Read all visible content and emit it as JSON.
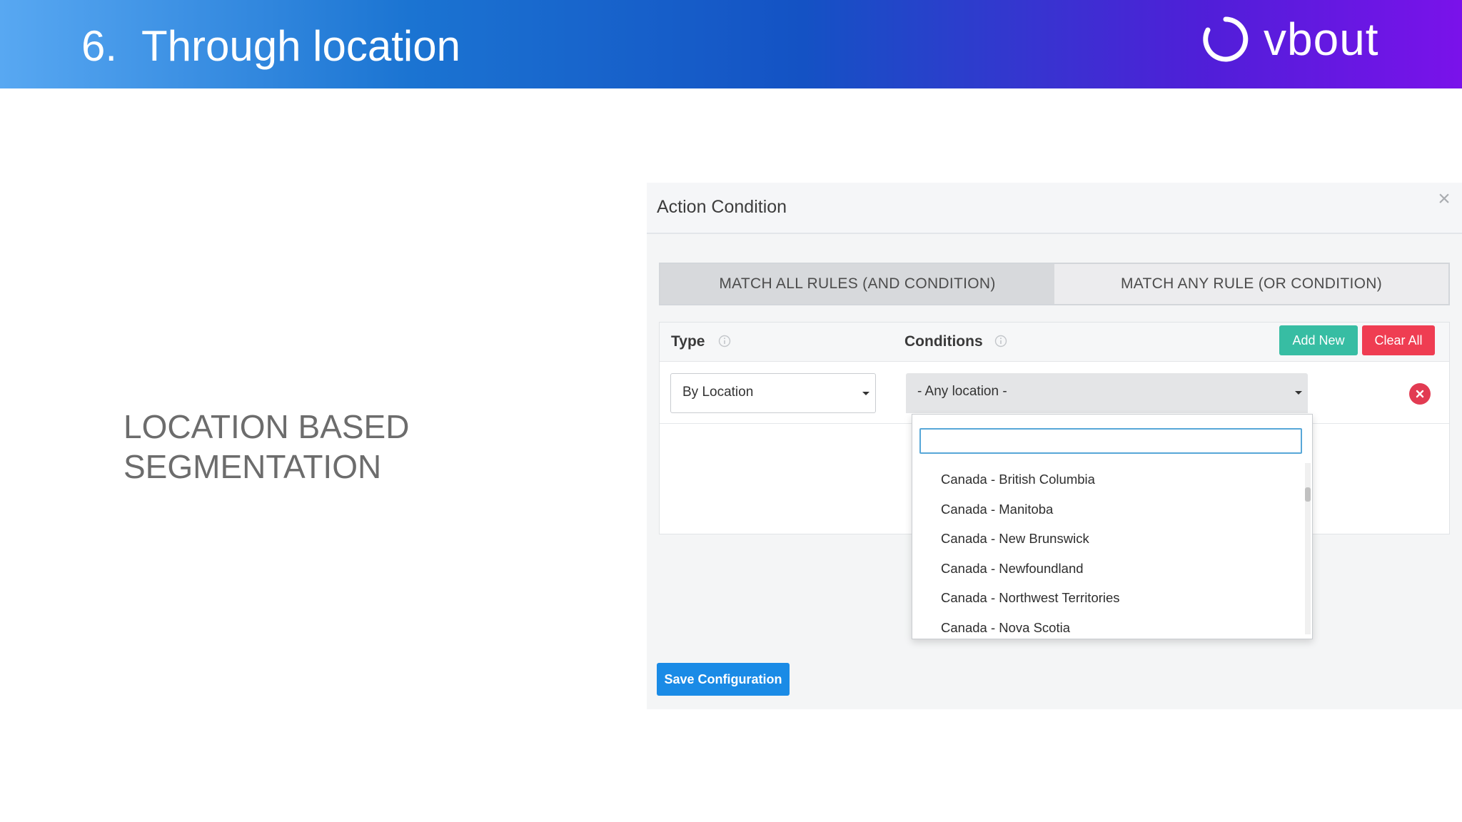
{
  "header": {
    "number": "6.",
    "title": "Through location",
    "logo_text": "vbout"
  },
  "caption": {
    "line1": "LOCATION BASED",
    "line2": "SEGMENTATION"
  },
  "modal": {
    "title": "Action Condition",
    "close_glyph": "×",
    "match_all_label": "MATCH ALL RULES (AND CONDITION)",
    "match_any_label": "MATCH ANY RULE (OR CONDITION)",
    "type_label": "Type",
    "conditions_label": "Conditions",
    "add_new_label": "Add New",
    "clear_all_label": "Clear All",
    "type_value": "By Location",
    "condition_value": "- Any location -",
    "search_value": "",
    "options": [
      "Canada - British Columbia",
      "Canada - Manitoba",
      "Canada - New Brunswick",
      "Canada - Newfoundland",
      "Canada - Northwest Territories",
      "Canada - Nova Scotia"
    ],
    "save_label": "Save Configuration"
  },
  "colors": {
    "add_new": "#37bda3",
    "clear_all": "#ef3d52",
    "save": "#1a8be6",
    "remove": "#e23b52"
  }
}
